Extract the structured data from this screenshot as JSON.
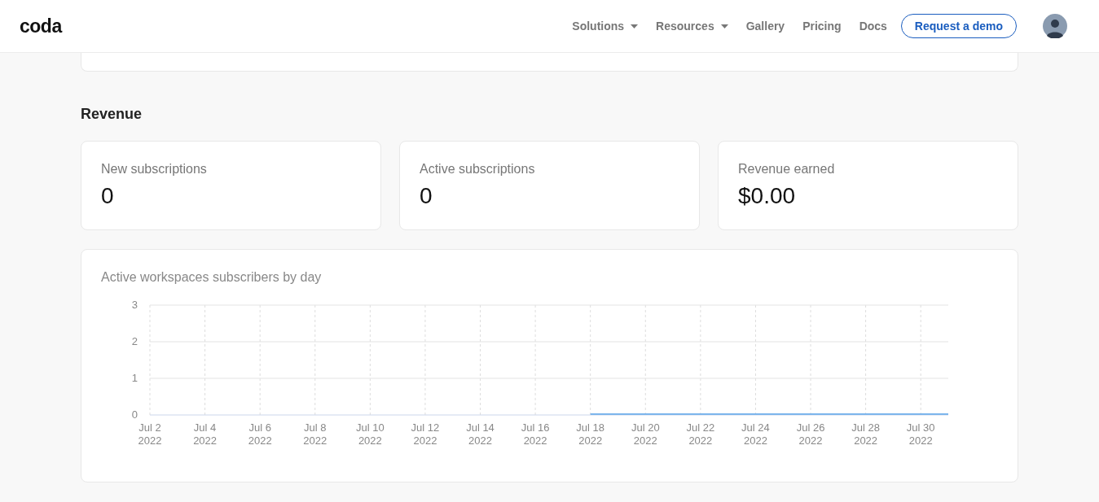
{
  "header": {
    "logo": "coda",
    "nav": [
      {
        "label": "Solutions",
        "dropdown": true
      },
      {
        "label": "Resources",
        "dropdown": true
      },
      {
        "label": "Gallery",
        "dropdown": false
      },
      {
        "label": "Pricing",
        "dropdown": false
      },
      {
        "label": "Docs",
        "dropdown": false
      }
    ],
    "cta": "Request a demo"
  },
  "section": {
    "title": "Revenue"
  },
  "stats": [
    {
      "label": "New subscriptions",
      "value": "0"
    },
    {
      "label": "Active subscriptions",
      "value": "0"
    },
    {
      "label": "Revenue earned",
      "value": "$0.00"
    }
  ],
  "chart_card": {
    "title": "Active workspaces subscribers by day",
    "chart_data": {
      "type": "line",
      "categories": [
        "Jul 2 2022",
        null,
        "Jul 4 2022",
        null,
        "Jul 6 2022",
        null,
        "Jul 8 2022",
        null,
        "Jul 10 2022",
        null,
        "Jul 12 2022",
        null,
        "Jul 14 2022",
        null,
        "Jul 16 2022",
        null,
        "Jul 18 2022",
        null,
        "Jul 20 2022",
        null,
        "Jul 22 2022",
        null,
        "Jul 24 2022",
        null,
        "Jul 26 2022",
        null,
        "Jul 28 2022",
        null,
        "Jul 30 2022",
        null
      ],
      "series": [
        {
          "color": "#7cb5ec",
          "values": [
            null,
            null,
            null,
            null,
            null,
            null,
            null,
            null,
            null,
            null,
            null,
            null,
            null,
            null,
            null,
            null,
            0,
            0,
            0,
            0,
            0,
            0,
            0,
            0,
            0,
            0,
            0,
            0,
            0,
            0
          ]
        }
      ],
      "ylim": [
        0,
        3
      ],
      "yticks": [
        0,
        1,
        2,
        3
      ],
      "grid": true
    }
  }
}
